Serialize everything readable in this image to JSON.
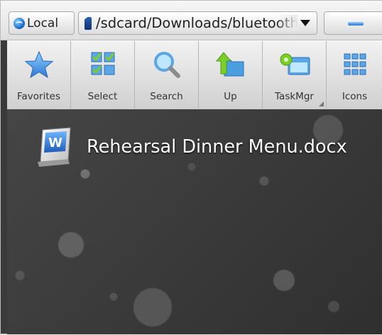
{
  "pathbar": {
    "local_label": "Local",
    "path": "/sdcard/Downloads/bluetooth"
  },
  "toolbar": {
    "tools": [
      {
        "label": "Favorites",
        "icon": "star-icon"
      },
      {
        "label": "Select",
        "icon": "select-icon"
      },
      {
        "label": "Search",
        "icon": "search-icon"
      },
      {
        "label": "Up",
        "icon": "up-folder-icon"
      },
      {
        "label": "TaskMgr",
        "icon": "task-manager-icon"
      },
      {
        "label": "Icons",
        "icon": "grid-icon"
      }
    ]
  },
  "files": [
    {
      "name": "Rehearsal Dinner Menu.docx",
      "icon": "word-document-icon"
    }
  ]
}
